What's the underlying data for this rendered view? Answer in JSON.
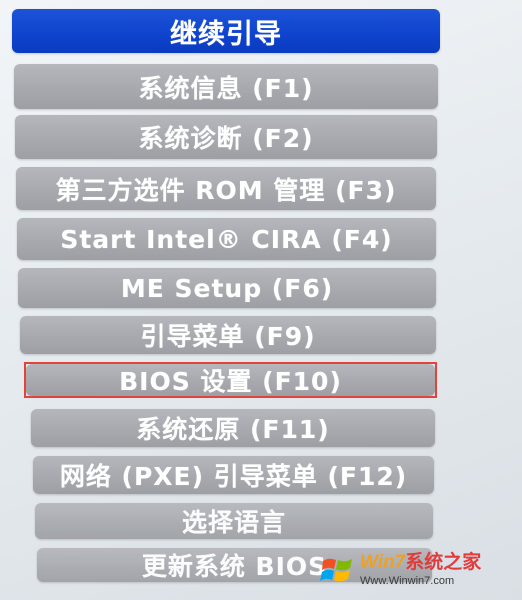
{
  "menu": {
    "items": [
      {
        "label": "继续引导",
        "selected": true
      },
      {
        "label": "系统信息 (F1)"
      },
      {
        "label": "系统诊断 (F2)"
      },
      {
        "label": "第三方选件 ROM 管理 (F3)"
      },
      {
        "label": "Start Intel® CIRA (F4)"
      },
      {
        "label": "ME Setup (F6)"
      },
      {
        "label": "引导菜单 (F9)"
      },
      {
        "label": "BIOS 设置 (F10)",
        "highlighted": true
      },
      {
        "label": "系统还原 (F11)"
      },
      {
        "label": "网络 (PXE) 引导菜单 (F12)"
      },
      {
        "label": "选择语言"
      },
      {
        "label": "更新系统 BIOS"
      }
    ]
  },
  "watermark": {
    "title_latin": "Win7",
    "title_cn": "系统之家",
    "url": "Www.Winwin7.com",
    "logo_icon": "windows-flag-icon"
  },
  "colors": {
    "selected_bg": "#1048d4",
    "item_bg": "#a9abb0",
    "highlight_border": "#e2433d"
  }
}
